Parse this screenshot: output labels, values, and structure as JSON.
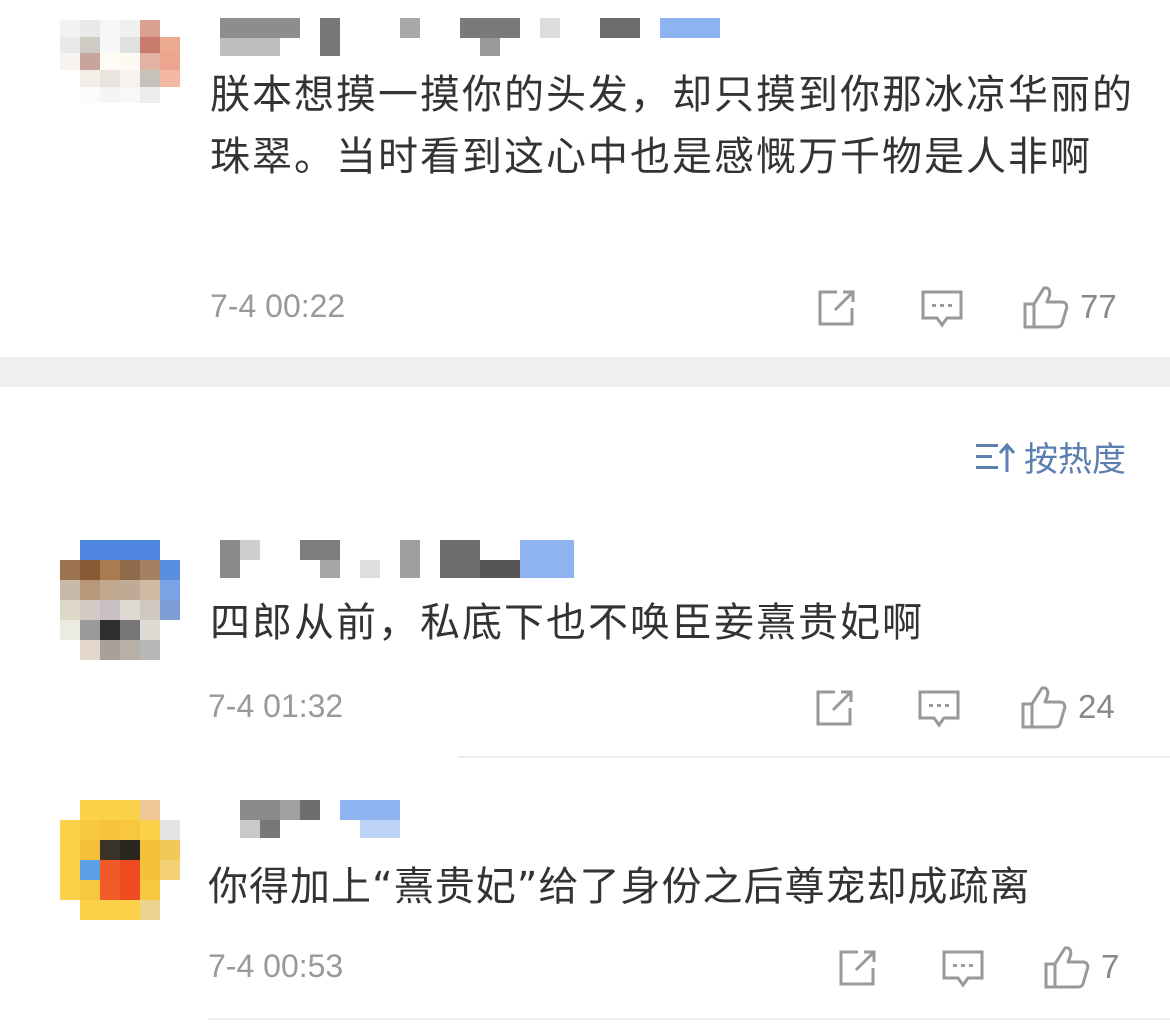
{
  "comments": [
    {
      "text": "朕本想摸一摸你的头发，却只摸到你那冰凉华丽的珠翠。当时看到这心中也是感慨万千物是人非啊",
      "time": "7-4 00:22",
      "likes": "77",
      "avatar_icon": "pixelated-avatar-icon"
    },
    {
      "text": "四郎从前，私底下也不唤臣妾熹贵妃啊",
      "time": "7-4 01:32",
      "likes": "24",
      "avatar_icon": "pixelated-avatar-icon"
    },
    {
      "text": "你得加上“熹贵妃”给了身份之后尊宠却成疏离",
      "time": "7-4 00:53",
      "likes": "7",
      "avatar_icon": "pixelated-avatar-icon"
    }
  ],
  "sort": {
    "label": "按热度",
    "icon": "sort-icon"
  },
  "colors": {
    "accent": "#5b7fb0",
    "meta": "#999999",
    "text": "#333333",
    "band": "#efefef"
  }
}
